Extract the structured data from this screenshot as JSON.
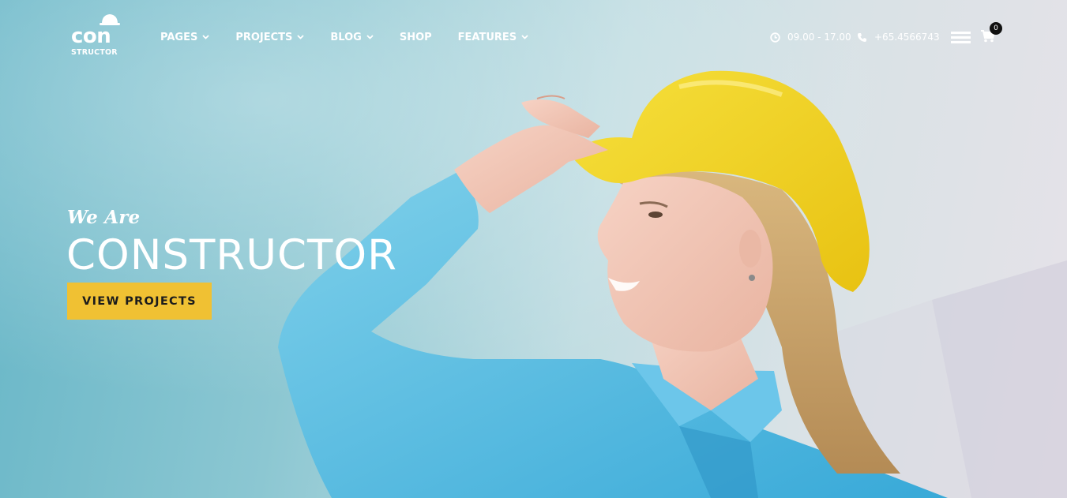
{
  "brand": {
    "logo_main": "con",
    "logo_sub": "STRUCTOR"
  },
  "nav": [
    {
      "label": "PAGES",
      "has_dropdown": true
    },
    {
      "label": "PROJECTS",
      "has_dropdown": true
    },
    {
      "label": "BLOG",
      "has_dropdown": true
    },
    {
      "label": "SHOP",
      "has_dropdown": false
    },
    {
      "label": "FEATURES",
      "has_dropdown": true
    }
  ],
  "contact": {
    "hours": "09.00 - 17.00",
    "phone": "+65.4566743"
  },
  "cart": {
    "count": "0"
  },
  "hero": {
    "tagline": "We Are",
    "headline": "CONSTRUCTOR",
    "cta_label": "VIEW PROJECTS"
  },
  "colors": {
    "accent": "#f0c133",
    "helmet": "#f2d21f",
    "shirt": "#4fb8df",
    "text": "#ffffff"
  },
  "icons": {
    "hours": "clock-icon",
    "phone": "phone-icon",
    "menu": "hamburger-icon",
    "cart": "shopping-cart-icon",
    "dropdown": "chevron-down-icon"
  }
}
